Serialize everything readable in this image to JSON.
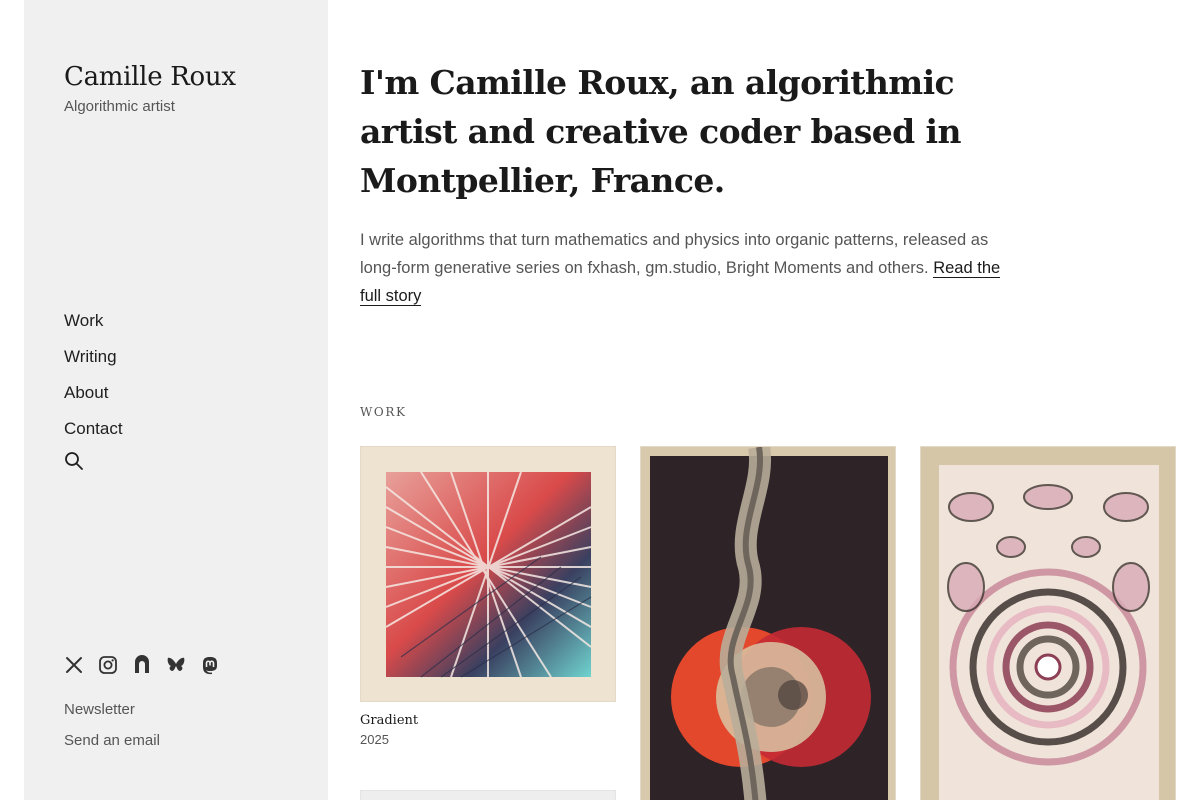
{
  "site": {
    "title": "Camille Roux",
    "subtitle": "Algorithmic artist"
  },
  "nav": {
    "items": [
      "Work",
      "Writing",
      "About",
      "Contact"
    ],
    "search_icon": "search-icon"
  },
  "social": {
    "icons": [
      "x-icon",
      "instagram-icon",
      "objkt-icon",
      "bluesky-icon",
      "mastodon-icon"
    ]
  },
  "footer": {
    "newsletter": "Newsletter",
    "email": "Send an email"
  },
  "hero": {
    "text": "I'm Camille Roux, an algorithmic artist and creative coder based in Montpellier, France."
  },
  "intro": {
    "text": "I write algorithms that turn mathematics and physics into organic patterns, released as long-form generative series on fxhash, gm.studio, Bright Moments and others. ",
    "link": "Read the full story"
  },
  "work": {
    "label": "WORK",
    "items": [
      {
        "title": "Gradient",
        "year": "2025"
      }
    ]
  },
  "colors": {
    "sidebar_bg": "#f0f0f0",
    "text": "#1a1a1a",
    "muted": "#555555"
  }
}
